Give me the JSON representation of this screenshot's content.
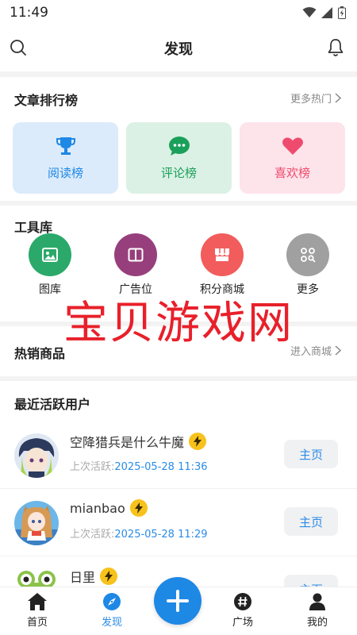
{
  "status_bar": {
    "time": "11:49"
  },
  "header": {
    "title": "发现"
  },
  "ranking": {
    "title": "文章排行榜",
    "more": "更多热门",
    "tiles": [
      {
        "label": "阅读榜",
        "icon": "trophy-icon",
        "color": "#1e88e5",
        "bg": "#dcebfb"
      },
      {
        "label": "评论榜",
        "icon": "comment-icon",
        "color": "#1aa05a",
        "bg": "#dcf1e5"
      },
      {
        "label": "喜欢榜",
        "icon": "heart-icon",
        "color": "#ef4b6e",
        "bg": "#fde3ea"
      }
    ]
  },
  "tools": {
    "title": "工具库",
    "items": [
      {
        "label": "图库",
        "icon": "image-icon",
        "color": "#2aa96a"
      },
      {
        "label": "广告位",
        "icon": "book-icon",
        "color": "#973f7c"
      },
      {
        "label": "积分商城",
        "icon": "store-icon",
        "color": "#f25c5c"
      },
      {
        "label": "更多",
        "icon": "grid-search-icon",
        "color": "#a0a0a0"
      }
    ]
  },
  "hot_products": {
    "title": "热销商品",
    "more": "进入商城"
  },
  "active_users": {
    "title": "最近活跃用户",
    "last_active_label": "上次活跃:",
    "home_label": "主页",
    "users": [
      {
        "name": "空降猎兵是什么牛魔",
        "time": "2025-05-28 11:36"
      },
      {
        "name": "mianbao",
        "time": "2025-05-28 11:29"
      },
      {
        "name": "日里",
        "time": ""
      }
    ]
  },
  "watermark": "宝贝游戏网",
  "tabbar": {
    "items": [
      {
        "label": "首页",
        "icon": "home-icon",
        "active": false
      },
      {
        "label": "发现",
        "icon": "compass-icon",
        "active": true
      },
      {
        "label": "广场",
        "icon": "hash-icon",
        "active": false
      },
      {
        "label": "我的",
        "icon": "person-icon",
        "active": false
      }
    ],
    "fab_icon": "plus-icon"
  },
  "colors": {
    "accent": "#1e88e5",
    "link": "#2a8be6",
    "badge": "#f7c21b"
  }
}
